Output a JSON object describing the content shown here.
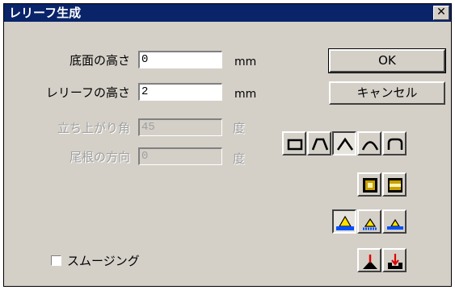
{
  "window": {
    "title": "レリーフ生成"
  },
  "fields": {
    "base_height": {
      "label": "底面の高さ",
      "value": "0",
      "unit": "mm"
    },
    "relief_height": {
      "label": "レリーフの高さ",
      "value": "2",
      "unit": "mm"
    },
    "rise_angle": {
      "label": "立ち上がり角",
      "value": "45",
      "unit": "度"
    },
    "ridge_direction": {
      "label": "尾根の方向",
      "value": "0",
      "unit": "度"
    }
  },
  "buttons": {
    "ok": "OK",
    "cancel": "キャンセル"
  },
  "smoothing": {
    "label": "スムージング",
    "checked": false
  },
  "icons": {
    "profile": [
      "flat-profile-icon",
      "trapezoid-profile-icon",
      "peak-profile-icon",
      "round-profile-icon",
      "rounded-rect-profile-icon"
    ],
    "fill": [
      "fill-inner-icon",
      "fill-band-icon"
    ],
    "base": [
      "base-full-icon",
      "base-mid-icon",
      "base-small-icon"
    ],
    "direction": [
      "direction-up-icon",
      "direction-down-icon"
    ],
    "accent": "#0a246a"
  }
}
